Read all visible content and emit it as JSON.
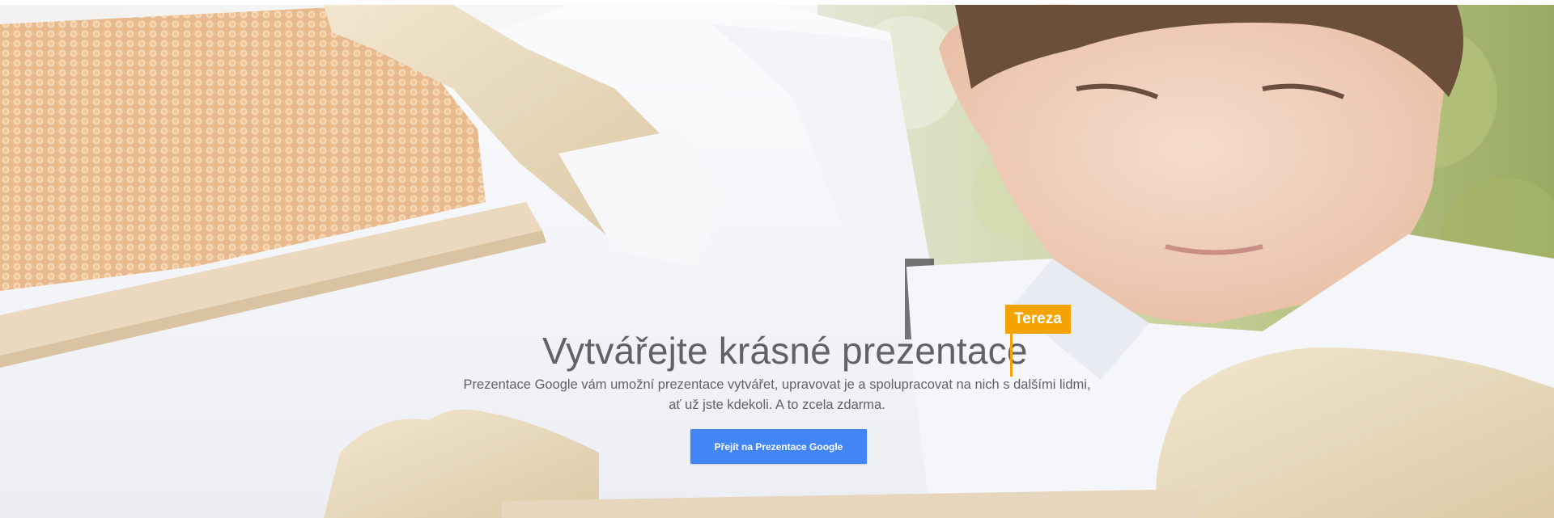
{
  "hero": {
    "headline": "Vytvářejte krásné prezentace",
    "collaborator_flag": "Tereza",
    "description_line1": "Prezentace Google vám umožní prezentace vytvářet, upravovat je a spolupracovat na nich s dalšími lidmi,",
    "description_line2": "ať už jste kdekoli. A to zcela zdarma.",
    "cta_label": "Přejít na Prezentace Google"
  },
  "colors": {
    "accent_flag": "#f4a300",
    "cta_background": "#4285f4",
    "headline_text": "#5f6368"
  }
}
